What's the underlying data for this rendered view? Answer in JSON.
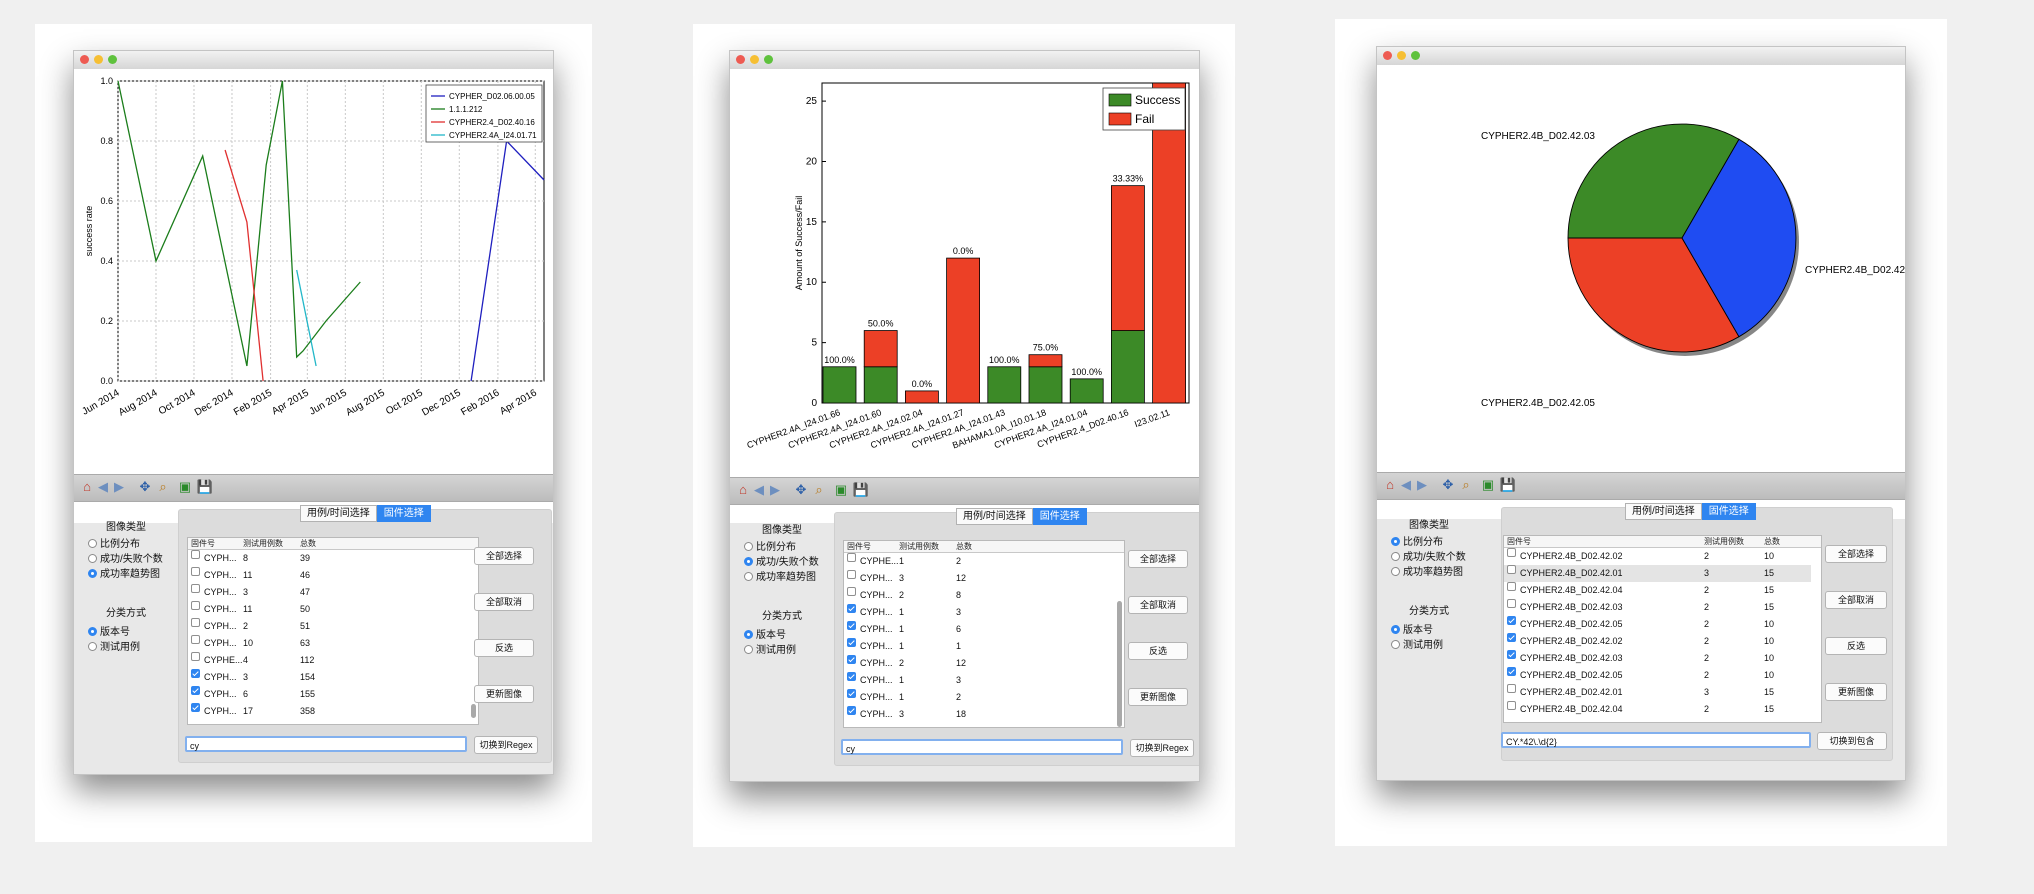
{
  "colors": {
    "accent": "#2f85f0",
    "green": "#3c8a27",
    "red": "#ec4026",
    "blue": "#1f4cf2"
  },
  "toolbar_icons": [
    "home-icon",
    "back-icon",
    "forward-icon",
    "pan-icon",
    "zoom-icon",
    "subplots-icon",
    "save-icon"
  ],
  "controls": {
    "tab_time": "用例/时间选择",
    "tab_firmware": "固件选择",
    "chart_type_label": "图像类型",
    "opt_ratio": "比例分布",
    "opt_count": "成功/失败个数",
    "opt_trend": "成功率趋势图",
    "category_label": "分类方式",
    "opt_version": "版本号",
    "opt_testcase": "测试用例",
    "col_firmware": "固件号",
    "col_cases": "测试用例数",
    "col_total": "总数",
    "btn_select_all": "全部选择",
    "btn_invert": "反选",
    "btn_update": "更新图像"
  },
  "windows": [
    {
      "chart_type": "trend",
      "category": "version",
      "clear_label": "全部取消",
      "filter_value": "cy",
      "toggle_label": "切换到Regex",
      "rows": [
        {
          "fw": "CYPH...",
          "cases": "8",
          "total": "39",
          "checked": false
        },
        {
          "fw": "CYPH...",
          "cases": "11",
          "total": "46",
          "checked": false
        },
        {
          "fw": "CYPH...",
          "cases": "3",
          "total": "47",
          "checked": false
        },
        {
          "fw": "CYPH...",
          "cases": "11",
          "total": "50",
          "checked": false
        },
        {
          "fw": "CYPH...",
          "cases": "2",
          "total": "51",
          "checked": false
        },
        {
          "fw": "CYPH...",
          "cases": "10",
          "total": "63",
          "checked": false
        },
        {
          "fw": "CYPHE...",
          "cases": "4",
          "total": "112",
          "checked": false
        },
        {
          "fw": "CYPH...",
          "cases": "3",
          "total": "154",
          "checked": true
        },
        {
          "fw": "CYPH...",
          "cases": "6",
          "total": "155",
          "checked": true
        },
        {
          "fw": "CYPH...",
          "cases": "17",
          "total": "358",
          "checked": true
        }
      ]
    },
    {
      "chart_type": "count",
      "category": "version",
      "clear_label": "全部取消",
      "filter_value": "cy",
      "toggle_label": "切换到Regex",
      "rows": [
        {
          "fw": "CYPHE...",
          "cases": "1",
          "total": "2",
          "checked": false
        },
        {
          "fw": "CYPH...",
          "cases": "3",
          "total": "12",
          "checked": false
        },
        {
          "fw": "CYPH...",
          "cases": "2",
          "total": "8",
          "checked": false
        },
        {
          "fw": "CYPH...",
          "cases": "1",
          "total": "3",
          "checked": true
        },
        {
          "fw": "CYPH...",
          "cases": "1",
          "total": "6",
          "checked": true
        },
        {
          "fw": "CYPH...",
          "cases": "1",
          "total": "1",
          "checked": true
        },
        {
          "fw": "CYPH...",
          "cases": "2",
          "total": "12",
          "checked": true
        },
        {
          "fw": "CYPH...",
          "cases": "1",
          "total": "3",
          "checked": true
        },
        {
          "fw": "CYPH...",
          "cases": "1",
          "total": "2",
          "checked": true
        },
        {
          "fw": "CYPH...",
          "cases": "3",
          "total": "18",
          "checked": true
        }
      ]
    },
    {
      "chart_type": "ratio",
      "category": "version",
      "clear_label": "全部取消",
      "filter_value": "CY.*42\\.\\d{2}",
      "toggle_label": "切换到包含",
      "rows": [
        {
          "fw": "CYPHER2.4B_D02.42.02",
          "cases": "2",
          "total": "10",
          "checked": false
        },
        {
          "fw": "CYPHER2.4B_D02.42.01",
          "cases": "3",
          "total": "15",
          "checked": false,
          "selected": true
        },
        {
          "fw": "CYPHER2.4B_D02.42.04",
          "cases": "2",
          "total": "15",
          "checked": false
        },
        {
          "fw": "CYPHER2.4B_D02.42.03",
          "cases": "2",
          "total": "15",
          "checked": false
        },
        {
          "fw": "CYPHER2.4B_D02.42.05",
          "cases": "2",
          "total": "10",
          "checked": true
        },
        {
          "fw": "CYPHER2.4B_D02.42.02",
          "cases": "2",
          "total": "10",
          "checked": true
        },
        {
          "fw": "CYPHER2.4B_D02.42.03",
          "cases": "2",
          "total": "10",
          "checked": true
        },
        {
          "fw": "CYPHER2.4B_D02.42.05",
          "cases": "2",
          "total": "10",
          "checked": true
        },
        {
          "fw": "CYPHER2.4B_D02.42.01",
          "cases": "3",
          "total": "15",
          "checked": false
        },
        {
          "fw": "CYPHER2.4B_D02.42.04",
          "cases": "2",
          "total": "15",
          "checked": false
        }
      ]
    }
  ],
  "chart_data": [
    {
      "type": "line",
      "ylabel": "success rate",
      "ylim": [
        0,
        1.0
      ],
      "yticks": [
        "0.0",
        "0.2",
        "0.4",
        "0.6",
        "0.8",
        "1.0"
      ],
      "xticks": [
        "Jun 2014",
        "Aug 2014",
        "Oct 2014",
        "Dec 2014",
        "Feb 2015",
        "Apr 2015",
        "Jun 2015",
        "Aug 2015",
        "Oct 2015",
        "Dec 2015",
        "Feb 2016",
        "Apr 2016"
      ],
      "xlim": [
        "2014-06-01",
        "2016-04-15"
      ],
      "grid": true,
      "legend_position": "top-right",
      "series": [
        {
          "name": "CYPHER_D02.06.00.05",
          "color": "#1f1fbf",
          "points": [
            [
              "2015-12-20",
              0.0
            ],
            [
              "2016-02-15",
              0.8
            ],
            [
              "2016-04-15",
              0.67
            ]
          ]
        },
        {
          "name": "1.1.1.212",
          "color": "#1b7d1b",
          "points": [
            [
              "2014-06-01",
              1.0
            ],
            [
              "2014-08-01",
              0.4
            ],
            [
              "2014-10-15",
              0.75
            ],
            [
              "2014-12-25",
              0.05
            ],
            [
              "2015-01-25",
              0.72
            ],
            [
              "2015-02-20",
              1.0
            ],
            [
              "2015-03-15",
              0.08
            ],
            [
              "2015-03-25",
              0.1
            ],
            [
              "2015-05-01",
              0.2
            ],
            [
              "2015-06-25",
              0.33
            ]
          ]
        },
        {
          "name": "CYPHER2.4_D02.40.16",
          "color": "#e03030",
          "points": [
            [
              "2014-11-20",
              0.77
            ],
            [
              "2014-12-25",
              0.53
            ],
            [
              "2015-01-20",
              0.0
            ]
          ]
        },
        {
          "name": "CYPHER2.4A_I24.01.71",
          "color": "#22b7c8",
          "points": [
            [
              "2015-03-15",
              0.37
            ],
            [
              "2015-04-15",
              0.05
            ]
          ]
        }
      ]
    },
    {
      "type": "bar",
      "ylabel": "Amount of Success/Fail",
      "ylim": [
        0,
        26.5
      ],
      "yticks": [
        0,
        5,
        10,
        15,
        20,
        25
      ],
      "legend_position": "top-right",
      "categories": [
        "CYPHER2.4A_I24.01.66",
        "CYPHER2.4A_I24.01.60",
        "CYPHER2.4A_I24.02.04",
        "CYPHER2.4A_I24.01.27",
        "CYPHER2.4A_I24.01.43",
        "BAHAMA1.0A_I10.01.18",
        "CYPHER2.4A_I24.01.04",
        "CYPHER2.4_D02.40.16",
        "I23.02.11"
      ],
      "series": [
        {
          "name": "Success",
          "color": "#3c8a27",
          "values": [
            3,
            3,
            0,
            0,
            3,
            3,
            2,
            6,
            0
          ]
        },
        {
          "name": "Fail",
          "color": "#ec4026",
          "values": [
            0,
            3,
            1,
            12,
            0,
            1,
            0,
            12,
            26.5
          ]
        }
      ],
      "data_labels": [
        "100.0%",
        "50.0%",
        "0.0%",
        "0.0%",
        "100.0%",
        "75.0%",
        "100.0%",
        "33.33%",
        ""
      ]
    },
    {
      "type": "pie",
      "labels": [
        "CYPHER2.4B_D02.42.03",
        "CYPHER2.4B_D02.42.05",
        "CYPHER2.4B_D02.42"
      ],
      "values": [
        1,
        1,
        1
      ],
      "colors": [
        "#3c8a27",
        "#ec4026",
        "#1f4cf2"
      ]
    }
  ]
}
